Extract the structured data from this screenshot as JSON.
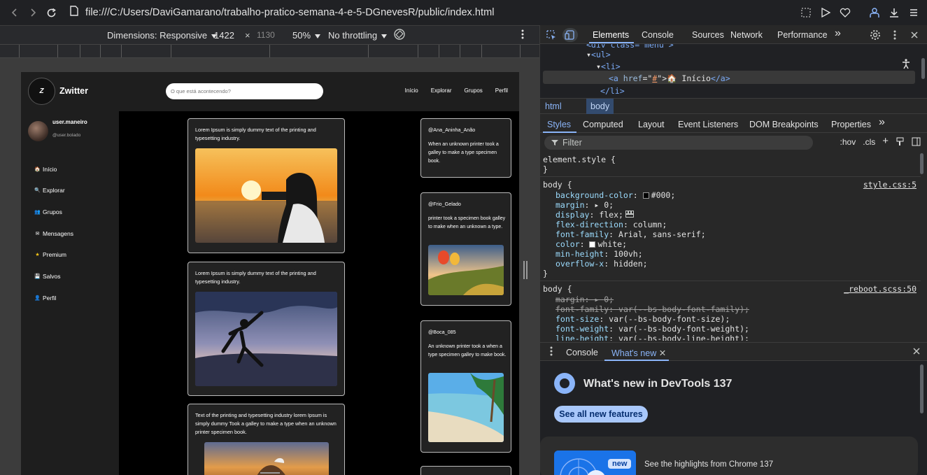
{
  "browser": {
    "url": "file:///C:/Users/DaviGamarano/trabalho-pratico-semana-4-e-5-DGnevesR/public/index.html"
  },
  "device_toolbar": {
    "dimensions_label": "Dimensions: Responsive",
    "width": "1422",
    "times": "×",
    "height": "1130",
    "zoom": "50%",
    "throttling": "No throttling"
  },
  "site": {
    "logo_letter": "Z",
    "brand": "Zwitter",
    "search_placeholder": "O que está acontecendo?",
    "nav": [
      "Início",
      "Explorar",
      "Grupos",
      "Perfil"
    ],
    "user": {
      "name": "user.maneiro",
      "handle": "@user.bolado"
    },
    "sidebar": [
      {
        "icon": "🏠",
        "label": "Início"
      },
      {
        "icon": "🔍",
        "label": "Explorar"
      },
      {
        "icon": "👥",
        "label": "Grupos"
      },
      {
        "icon": "✉",
        "label": "Mensagens"
      },
      {
        "icon": "★",
        "label": "Premium"
      },
      {
        "icon": "💾",
        "label": "Salvos"
      },
      {
        "icon": "👤",
        "label": "Perfil"
      }
    ],
    "posts": [
      {
        "text": "Lorem Ipsum is simply dummy text of the printing and typesetting industry."
      },
      {
        "text": "Lorem Ipsum is simply dummy text of the printing and typesetting industry."
      },
      {
        "text": "Text of the printing and typesetting industry lorem Ipsum is simply dummy Took a galley to make a type when an unknown printer specimen book."
      }
    ],
    "trends": [
      {
        "handle": "@Ana_Aninha_Anão",
        "text": "When an unknown printer took a galley to make a type specimen book."
      },
      {
        "handle": "@Frio_Gelado",
        "text": "printer took a specimen book galley to make when an unknown a type."
      },
      {
        "handle": "@Boca_085",
        "text": "An unknown printer took a when a type specimen galley to make book."
      }
    ]
  },
  "devtools": {
    "tabs": [
      "Elements",
      "Console",
      "Sources",
      "Network",
      "Performance"
    ],
    "more": "»",
    "dom": {
      "line0": "<div class=\"menu\">",
      "line1_tag": "ul",
      "line2_tag": "li",
      "line3_attr": "href",
      "line3_val": "#",
      "line3_text": "Início",
      "line4_tag": "/li"
    },
    "breadcrumbs": [
      "html",
      "body"
    ],
    "style_tabs": [
      "Styles",
      "Computed",
      "Layout",
      "Event Listeners",
      "DOM Breakpoints",
      "Properties"
    ],
    "filter_placeholder": "Filter",
    "filter_buttons": [
      ":hov",
      ".cls",
      "+"
    ],
    "rules": {
      "element_style": "element.style {",
      "close": "}",
      "body_sel": "body {",
      "body_src": "style.css:5",
      "decls": [
        {
          "p": "background-color",
          "v": "#000;"
        },
        {
          "p": "margin",
          "v": "0;"
        },
        {
          "p": "display",
          "v": "flex;"
        },
        {
          "p": "flex-direction",
          "v": "column;"
        },
        {
          "p": "font-family",
          "v": "Arial, sans-serif;"
        },
        {
          "p": "color",
          "v": "white;"
        },
        {
          "p": "min-height",
          "v": "100vh;"
        },
        {
          "p": "overflow-x",
          "v": "hidden;"
        }
      ],
      "reboot_src": "_reboot.scss:50",
      "reboot_decls": [
        {
          "p": "margin",
          "v": "0;"
        },
        {
          "p": "font-family",
          "v": "var(--bs-body-font-family);"
        },
        {
          "p": "font-size",
          "v": "var(--bs-body-font-size);"
        },
        {
          "p": "font-weight",
          "v": "var(--bs-body-font-weight);"
        },
        {
          "p": "line-height",
          "v": "var(--bs-body-line-height);"
        }
      ]
    },
    "drawer": {
      "tabs": [
        "Console",
        "What's new"
      ],
      "title": "What's new in DevTools 137",
      "button": "See all new features",
      "badge": "new",
      "highlight": "See the highlights from Chrome 137"
    }
  }
}
